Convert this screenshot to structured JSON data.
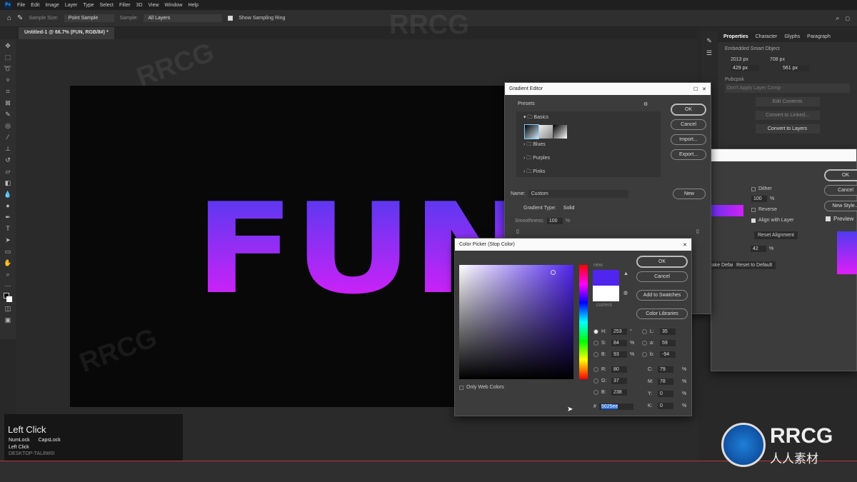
{
  "menu": [
    "File",
    "Edit",
    "Image",
    "Layer",
    "Type",
    "Select",
    "Filter",
    "3D",
    "View",
    "Window",
    "Help"
  ],
  "options": {
    "sample_size_label": "Sample Size:",
    "sample_size": "Point Sample",
    "sample_label": "Sample:",
    "sample": "All Layers",
    "show_ring": "Show Sampling Ring"
  },
  "doc_tab": "Untitled-1 @ 66.7% (FUN, RGB/8#) *",
  "canvas_text": "FUN",
  "properties": {
    "tabs": [
      "Properties",
      "Character",
      "Glyphs",
      "Paragraph"
    ],
    "type": "Embedded Smart Object",
    "w": "2013 px",
    "h": "708 px",
    "x": "429 px",
    "y": "561 px",
    "comps_label": "Pubcpsk",
    "comps_value": "Don't Apply Layer Comp",
    "buttons": [
      "Edit Contents",
      "Convert to Linked...",
      "Convert to Layers"
    ]
  },
  "gradient_editor": {
    "title": "Gradient Editor",
    "presets_label": "Presets",
    "folders": [
      "Basics",
      "Blues",
      "Purples",
      "Pinks"
    ],
    "buttons": [
      "OK",
      "Cancel",
      "Import...",
      "Export..."
    ],
    "name_label": "Name:",
    "name": "Custom",
    "new": "New",
    "type_label": "Gradient Type:",
    "type": "Solid",
    "smooth_label": "Smoothness:",
    "smooth": "100",
    "pct": "%"
  },
  "color_picker": {
    "title": "Color Picker (Stop Color)",
    "new_label": "new",
    "current_label": "current",
    "new_color": "#5025ee",
    "current_color": "#ffffff",
    "buttons": [
      "OK",
      "Cancel",
      "Add to Swatches",
      "Color Libraries"
    ],
    "only_web": "Only Web Colors",
    "hsb": [
      {
        "l": "H:",
        "v": "253",
        "u": "°"
      },
      {
        "l": "S:",
        "v": "84",
        "u": "%"
      },
      {
        "l": "B:",
        "v": "93",
        "u": "%"
      }
    ],
    "rgb": [
      {
        "l": "R:",
        "v": "80"
      },
      {
        "l": "G:",
        "v": "37"
      },
      {
        "l": "B:",
        "v": "238"
      }
    ],
    "lab": [
      {
        "l": "L:",
        "v": "35"
      },
      {
        "l": "a:",
        "v": "59"
      },
      {
        "l": "b:",
        "v": "-94"
      }
    ],
    "cmyk": [
      {
        "l": "C:",
        "v": "79"
      },
      {
        "l": "M:",
        "v": "78"
      },
      {
        "l": "Y:",
        "v": "0"
      },
      {
        "l": "K:",
        "v": "0"
      }
    ],
    "hex_label": "#",
    "hex": "5025ee"
  },
  "gradient_fill": {
    "buttons": [
      "OK",
      "Cancel",
      "New Style..."
    ],
    "dither": "Dither",
    "opacity": "100",
    "reverse": "Reverse",
    "align": "Align with Layer",
    "reset_align": "Reset Alignment",
    "angle": "42",
    "make_default": "Make Default",
    "reset_default": "Reset to Default",
    "preview": "Preview"
  },
  "overlay": {
    "title": "Left Click",
    "keys": [
      "NumLock",
      "CapsLock"
    ],
    "line": "Left Click",
    "code": "DESKTOP-TAL8W0I"
  },
  "logo": {
    "text": "RRCG",
    "sub": "人人素材"
  },
  "watermark": "RRCG"
}
